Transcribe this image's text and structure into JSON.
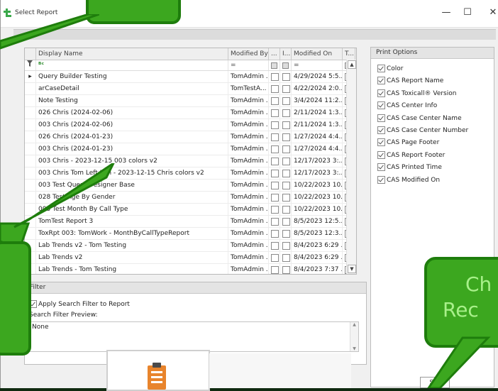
{
  "window": {
    "title": "Select Report"
  },
  "titlebar_controls": {
    "minimize": "—",
    "maximize": "☐",
    "close": "✕"
  },
  "grid": {
    "columns": [
      "Display Name",
      "Modified By",
      "...",
      "I...",
      "Modified On",
      "T..."
    ],
    "filter_row": {
      "name_filter": "ᴮᶜ",
      "modified_by": "=",
      "modified_on": "="
    },
    "rows": [
      {
        "name": "Query Builder Testing",
        "by": "TomAdmin ...",
        "on": "4/29/2024 5:5...",
        "expand": "▸"
      },
      {
        "name": "arCaseDetail",
        "by": "TomTestA...",
        "on": "4/22/2024 2:0..."
      },
      {
        "name": "Note Testing",
        "by": "TomAdmin ...",
        "on": "3/4/2024 11:2..."
      },
      {
        "name": "026 Chris (2024-02-06)",
        "by": "TomAdmin ...",
        "on": "2/11/2024 1:3..."
      },
      {
        "name": "003 Chris (2024-02-06)",
        "by": "TomAdmin ...",
        "on": "2/11/2024 1:3..."
      },
      {
        "name": "026 Chris (2024-01-23)",
        "by": "TomAdmin ...",
        "on": "1/27/2024 4:4..."
      },
      {
        "name": "003 Chris (2024-01-23)",
        "by": "TomAdmin ...",
        "on": "1/27/2024 4:4..."
      },
      {
        "name": "003 Chris - 2023-12-15 003 colors v2",
        "by": "TomAdmin ...",
        "on": "12/17/2023 3:..."
      },
      {
        "name": "003 Chris Tom Left Join - 2023-12-15 Chris colors v2",
        "by": "TomAdmin ...",
        "on": "12/17/2023 3:..."
      },
      {
        "name": "003 Test Query Designer Base",
        "by": "TomAdmin ...",
        "on": "10/22/2023 10..."
      },
      {
        "name": "028 Test Age By Gender",
        "by": "TomAdmin ...",
        "on": "10/22/2023 10..."
      },
      {
        "name": "003 Test Month By Call Type",
        "by": "TomAdmin ...",
        "on": "10/22/2023 10..."
      },
      {
        "name": "TomTest Report 3",
        "by": "TomAdmin ...",
        "on": "8/5/2023 12:5..."
      },
      {
        "name": "ToxRpt 003: TomWork - MonthByCallTypeReport",
        "by": "TomAdmin ...",
        "on": "8/5/2023 12:3..."
      },
      {
        "name": "Lab Trends v2 - Tom Testing",
        "by": "TomAdmin ...",
        "on": "8/4/2023 6:29 ..."
      },
      {
        "name": "Lab Trends v2",
        "by": "TomAdmin ...",
        "on": "8/4/2023 6:29 ..."
      },
      {
        "name": "Lab Trends - Tom Testing",
        "by": "TomAdmin ...",
        "on": "8/4/2023 7:37 ..."
      }
    ]
  },
  "print_options": {
    "header": "Print Options",
    "items": [
      "Color",
      "CAS Report Name",
      "CAS Toxicall® Version",
      "CAS Center Info",
      "CAS Case Center Name",
      "CAS Case Center Number",
      "CAS Page Footer",
      "CAS Report Footer",
      "CAS Printed Time",
      "CAS Modified On"
    ]
  },
  "filter": {
    "header": "Filter",
    "apply_label": "Apply Search Filter to Report",
    "preview_label": "Search Filter Preview:",
    "preview_value": "None"
  },
  "buttons": {
    "show": "Sho"
  },
  "callouts": {
    "right_line1": "Ch",
    "right_line2": "Rec"
  },
  "colors": {
    "callout_green": "#3ca71f",
    "callout_border": "#1e7d0c",
    "callout_text": "#a8f08a"
  }
}
